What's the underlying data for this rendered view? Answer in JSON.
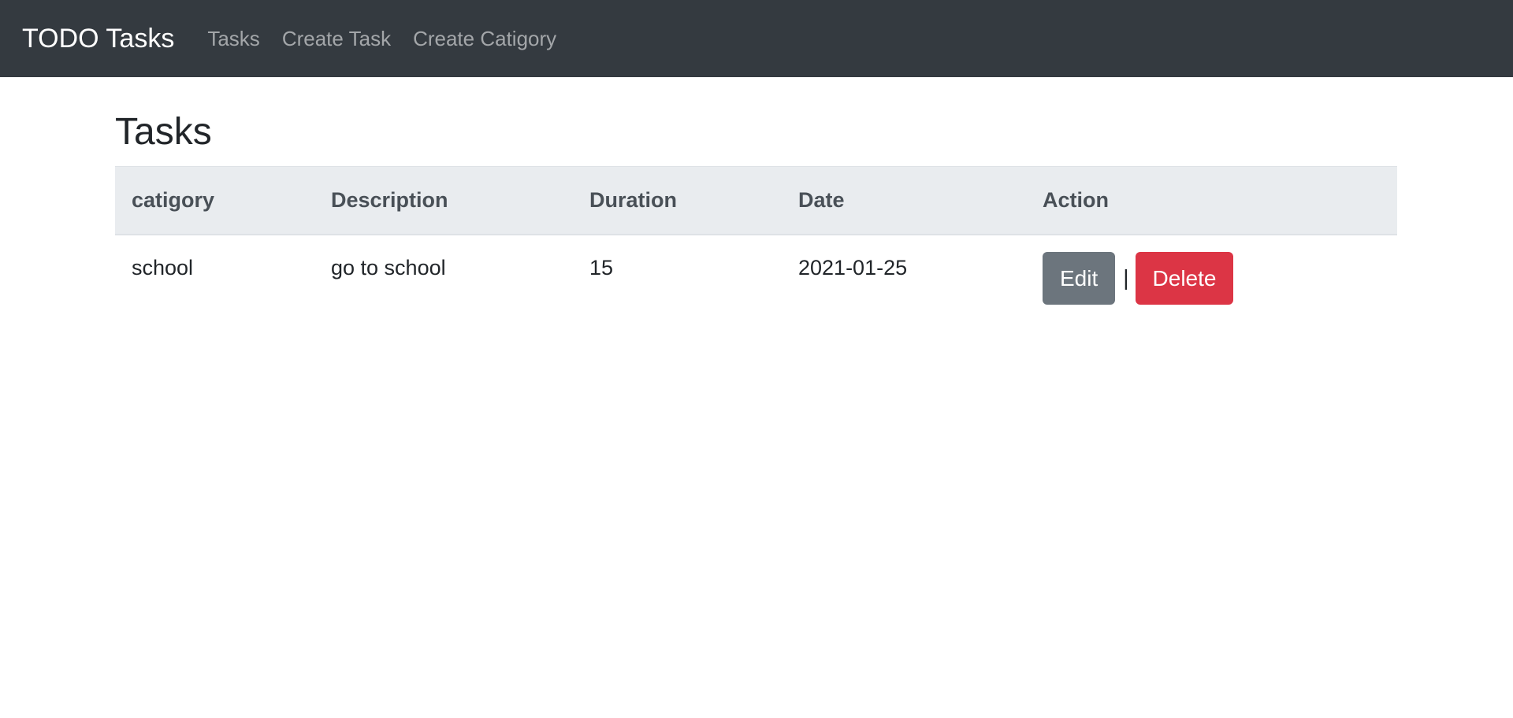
{
  "navbar": {
    "brand": "TODO Tasks",
    "links": [
      "Tasks",
      "Create Task",
      "Create Catigory"
    ]
  },
  "main": {
    "title": "Tasks",
    "table": {
      "headers": [
        "catigory",
        "Description",
        "Duration",
        "Date",
        "Action"
      ],
      "rows": [
        {
          "category": "school",
          "description": "go to school",
          "duration": "15",
          "date": "2021-01-25",
          "edit_label": "Edit",
          "separator": "|",
          "delete_label": "Delete"
        }
      ]
    }
  },
  "colors": {
    "navbar_bg": "#343a40",
    "header_bg": "#e9ecef",
    "edit_button": "#6c757d",
    "delete_button": "#dc3545"
  }
}
